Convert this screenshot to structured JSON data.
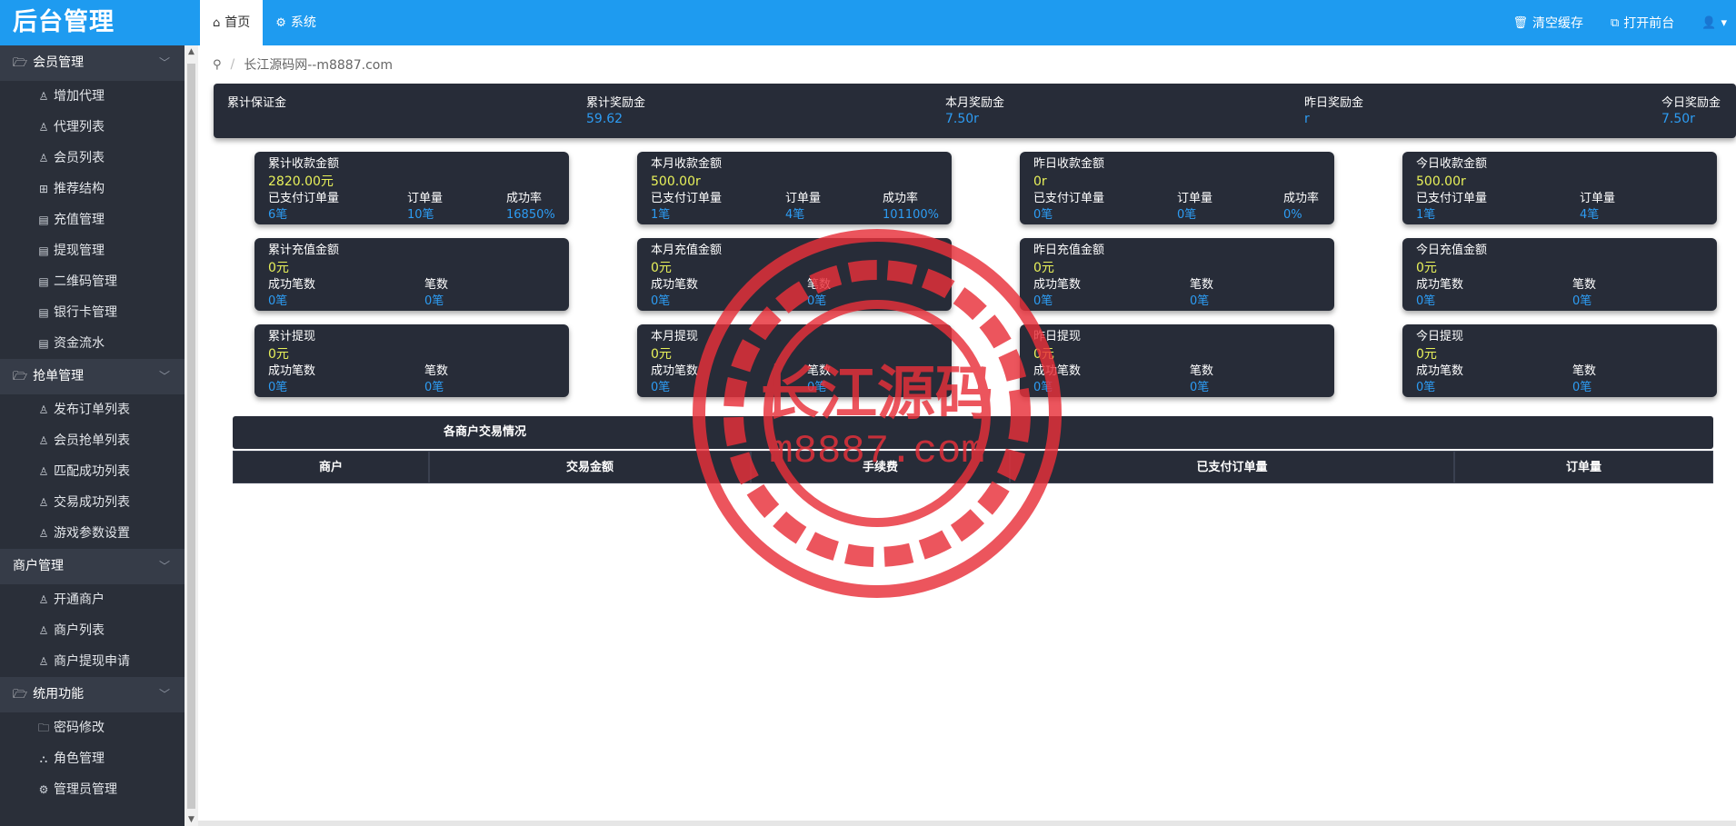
{
  "app": {
    "title": "后台管理"
  },
  "header": {
    "tabs": [
      {
        "icon": "home-icon",
        "label": "首页",
        "active": true
      },
      {
        "icon": "gear-icon",
        "label": "系统",
        "active": false
      }
    ],
    "actions": [
      {
        "icon": "trash-icon",
        "label": "清空缓存"
      },
      {
        "icon": "external-link-icon",
        "label": "打开前台"
      }
    ]
  },
  "sidebar": {
    "groups": [
      {
        "label": "会员管理",
        "items": [
          "增加代理",
          "代理列表",
          "会员列表",
          "推荐结构",
          "充值管理",
          "提现管理",
          "二维码管理",
          "银行卡管理",
          "资金流水"
        ]
      },
      {
        "label": "抢单管理",
        "items": [
          "发布订单列表",
          "会员抢单列表",
          "匹配成功列表",
          "交易成功列表",
          "游戏参数设置"
        ]
      },
      {
        "label": "商户管理",
        "items": [
          "开通商户",
          "商户列表",
          "商户提现申请"
        ]
      },
      {
        "label": "统用功能",
        "items": [
          "密码修改",
          "角色管理",
          "管理员管理"
        ]
      }
    ]
  },
  "breadcrumb": {
    "separator": "/",
    "text": "长江源码网--m8887.com"
  },
  "summary": [
    {
      "label": "累计保证金",
      "value": ""
    },
    {
      "label": "累计奖励金",
      "value": "59.62"
    },
    {
      "label": "本月奖励金",
      "value": "7.50r"
    },
    {
      "label": "昨日奖励金",
      "value": "r"
    },
    {
      "label": "今日奖励金",
      "value": "7.50r"
    }
  ],
  "cards": {
    "row1": [
      {
        "title": "累计收款金额",
        "amount": "2820.00元",
        "labels": [
          "已支付订单量",
          "订单量",
          "成功率"
        ],
        "values": [
          "6笔",
          "10笔",
          "16850%"
        ]
      },
      {
        "title": "本月收款金额",
        "amount": "500.00r",
        "labels": [
          "已支付订单量",
          "订单量",
          "成功率"
        ],
        "values": [
          "1笔",
          "4笔",
          "101100%"
        ]
      },
      {
        "title": "昨日收款金额",
        "amount": "0r",
        "labels": [
          "已支付订单量",
          "订单量",
          "成功率"
        ],
        "values": [
          "0笔",
          "0笔",
          "0%"
        ]
      },
      {
        "title": "今日收款金额",
        "amount": "500.00r",
        "labels": [
          "已支付订单量",
          "订单量"
        ],
        "values": [
          "1笔",
          "4笔"
        ]
      }
    ],
    "row2": [
      {
        "title": "累计充值金额",
        "amount": "0元",
        "labels": [
          "成功笔数",
          "笔数"
        ],
        "values": [
          "0笔",
          "0笔"
        ]
      },
      {
        "title": "本月充值金额",
        "amount": "0元",
        "labels": [
          "成功笔数",
          "笔数"
        ],
        "values": [
          "0笔",
          "0笔"
        ]
      },
      {
        "title": "昨日充值金额",
        "amount": "0元",
        "labels": [
          "成功笔数",
          "笔数"
        ],
        "values": [
          "0笔",
          "0笔"
        ]
      },
      {
        "title": "今日充值金额",
        "amount": "0元",
        "labels": [
          "成功笔数",
          "笔数"
        ],
        "values": [
          "0笔",
          "0笔"
        ]
      }
    ],
    "row3": [
      {
        "title": "累计提现",
        "amount": "0元",
        "labels": [
          "成功笔数",
          "笔数"
        ],
        "values": [
          "0笔",
          "0笔"
        ]
      },
      {
        "title": "本月提现",
        "amount": "0元",
        "labels": [
          "成功笔数",
          "笔数"
        ],
        "values": [
          "0笔",
          "0笔"
        ]
      },
      {
        "title": "昨日提现",
        "amount": "0元",
        "labels": [
          "成功笔数",
          "笔数"
        ],
        "values": [
          "0笔",
          "0笔"
        ]
      },
      {
        "title": "今日提现",
        "amount": "0元",
        "labels": [
          "成功笔数",
          "笔数"
        ],
        "values": [
          "0笔",
          "0笔"
        ]
      }
    ]
  },
  "merchant_table": {
    "title": "各商户交易情况",
    "columns": [
      "商户",
      "交易金额",
      "手续费",
      "已支付订单量",
      "订单量"
    ]
  },
  "watermark": {
    "line1": "长江源码",
    "line2": "m8887.com"
  },
  "colors": {
    "header": "#1e9bf0",
    "sidebar": "#2a2f39",
    "card": "#272c38",
    "amount": "#e8f15a",
    "value": "#2d9cf3",
    "seal": "#e8303a"
  }
}
